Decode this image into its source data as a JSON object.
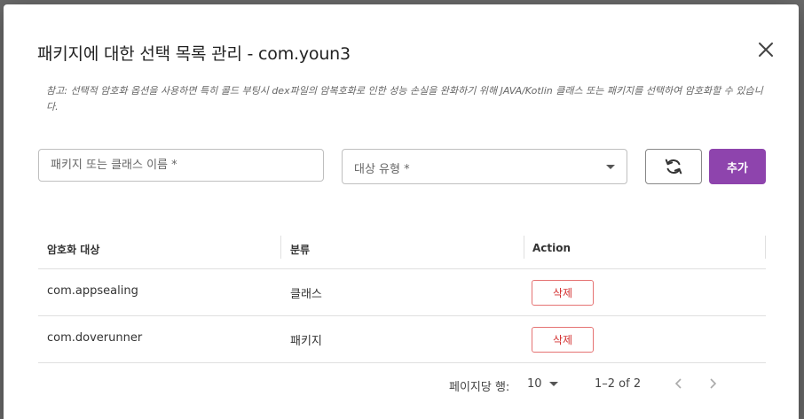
{
  "modal": {
    "title": "패키지에 대한 선택 목록 관리 - com.youn3",
    "note": "참고: 선택적 암호화 옵션을 사용하면 특히 콜드 부팅시 dex파일의 암복호화로 인한 성능 손실을 완화하기 위해 JAVA/Kotlin 클래스 또는 패키지를 선택하여 암호화할 수 있습니다."
  },
  "form": {
    "name_placeholder": "패키지 또는 클래스 이름 *",
    "type_placeholder": "대상 유형 *",
    "add_label": "추가"
  },
  "table": {
    "headers": [
      "암호화 대상",
      "분류",
      "Action"
    ],
    "rows": [
      {
        "target": "com.appsealing",
        "category": "클래스",
        "action": "삭제"
      },
      {
        "target": "com.doverunner",
        "category": "패키지",
        "action": "삭제"
      }
    ]
  },
  "pagination": {
    "rows_per_page_label": "페이지당 행:",
    "rows_per_page": "10",
    "range": "1–2 of 2"
  },
  "colors": {
    "accent": "#8e44ad",
    "delete": "#d32f2f"
  }
}
